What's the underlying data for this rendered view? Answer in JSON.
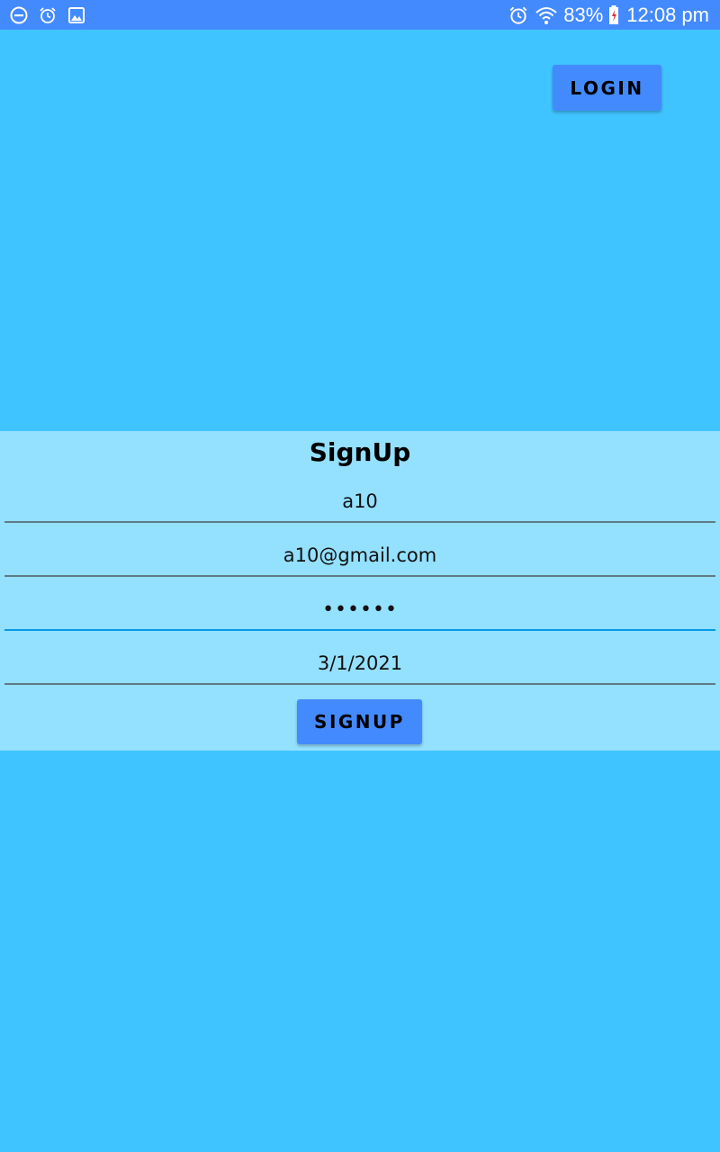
{
  "status_bar": {
    "left_icons": [
      "do-not-disturb-icon",
      "alarm-icon",
      "image-icon"
    ],
    "right_icons": [
      "alarm-icon",
      "wifi-icon",
      "battery-icon"
    ],
    "battery_percent": "83%",
    "time": "12:08 pm",
    "color": "#448aff"
  },
  "header": {
    "login_label": "LOGIN"
  },
  "signup": {
    "title": "SignUp",
    "name_value": "a10",
    "email_value": "a10@gmail.com",
    "password_value": "••••••",
    "date_value": "3/1/2021",
    "submit_label": "SIGNUP"
  },
  "colors": {
    "background": "#40c4ff",
    "panel": "#94e0ff",
    "button": "#448aff",
    "active_underline": "#039be5"
  }
}
